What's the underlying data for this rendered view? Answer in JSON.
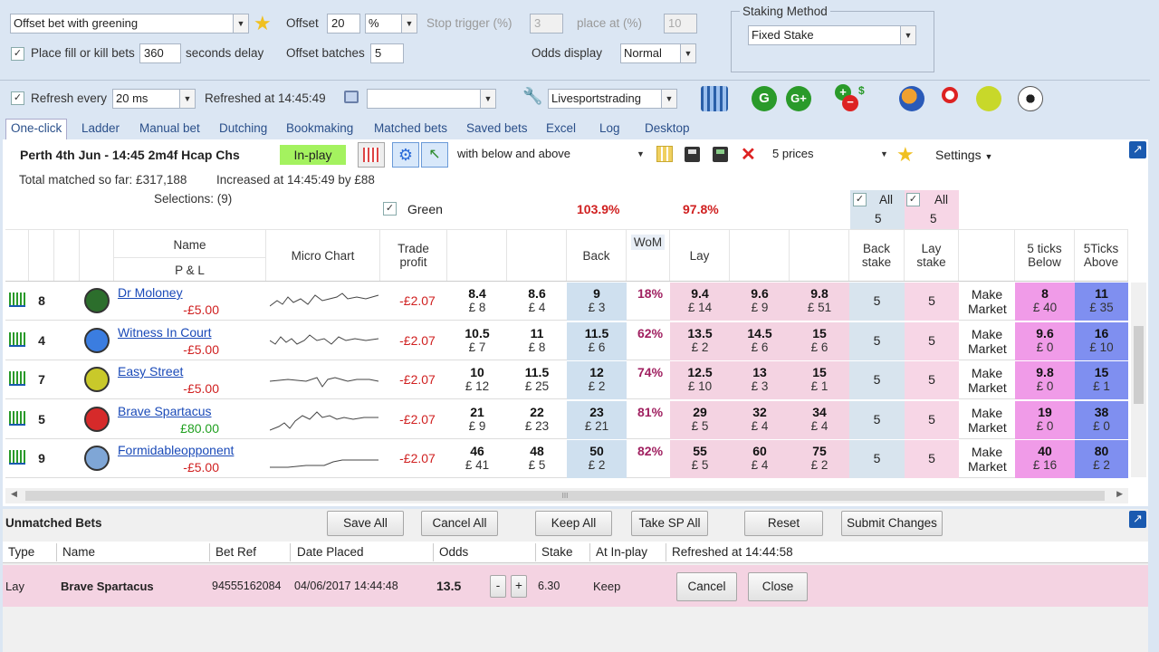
{
  "top": {
    "strategy": "Offset bet with greening",
    "offset_label": "Offset",
    "offset_value": "20",
    "offset_unit": "%",
    "stop_trigger_label": "Stop trigger (%)",
    "stop_trigger_value": "3",
    "place_at_label": "place at (%)",
    "place_at_value": "10",
    "fill_kill_label": "Place fill or kill bets",
    "fill_kill_value": "360",
    "seconds_delay_label": "seconds delay",
    "offset_batches_label": "Offset batches",
    "offset_batches_value": "5",
    "odds_display_label": "Odds display",
    "odds_display_value": "Normal",
    "staking_method_title": "Staking Method",
    "staking_method_value": "Fixed Stake",
    "refresh_label": "Refresh every",
    "refresh_value": "20 ms",
    "refreshed_at": "Refreshed at 14:45:49",
    "source_value": "Livesportstrading"
  },
  "tabs": [
    "One-click",
    "Ladder",
    "Manual bet",
    "Dutching",
    "Bookmaking",
    "Matched bets",
    "Saved bets",
    "Excel",
    "Log",
    "Desktop"
  ],
  "market": {
    "title": "Perth 4th Jun - 14:45 2m4f Hcap Chs",
    "status": "In-play",
    "filter": "with below and above",
    "prices": "5 prices",
    "settings": "Settings",
    "total_matched": "Total matched so far: £317,188",
    "increased": "Increased at 14:45:49 by £88",
    "selections": "Selections: (9)",
    "green_label": "Green",
    "back_book": "103.9%",
    "lay_book": "97.8%",
    "all_label": "All",
    "all_back_stake": "5",
    "all_lay_stake": "5"
  },
  "columns": {
    "name": "Name",
    "pl": "P & L",
    "micro_chart": "Micro Chart",
    "trade_profit": "Trade profit",
    "back": "Back",
    "wom": "WoM",
    "lay": "Lay",
    "back_stake": "Back stake",
    "lay_stake": "Lay stake",
    "ticks_below": "5 ticks Below",
    "ticks_above": "5Ticks Above"
  },
  "runners": [
    {
      "num": "8",
      "name": "Dr Moloney",
      "pl": "-£5.00",
      "trade": "-£2.07",
      "b3": "8.4",
      "b3s": "£ 8",
      "b2": "8.6",
      "b2s": "£ 4",
      "b1": "9",
      "b1s": "£ 3",
      "wom": "18%",
      "l1": "9.4",
      "l1s": "£ 14",
      "l2": "9.6",
      "l2s": "£ 9",
      "l3": "9.8",
      "l3s": "£ 51",
      "bs": "5",
      "ls": "5",
      "mm": "Make Market",
      "tb": "8",
      "tbs": "£ 40",
      "ta": "11",
      "tas": "£ 35",
      "silk": "#2c6e2c"
    },
    {
      "num": "4",
      "name": "Witness In Court",
      "pl": "-£5.00",
      "trade": "-£2.07",
      "b3": "10.5",
      "b3s": "£ 7",
      "b2": "11",
      "b2s": "£ 8",
      "b1": "11.5",
      "b1s": "£ 6",
      "wom": "62%",
      "l1": "13.5",
      "l1s": "£ 2",
      "l2": "14.5",
      "l2s": "£ 6",
      "l3": "15",
      "l3s": "£ 6",
      "bs": "5",
      "ls": "5",
      "mm": "Make Market",
      "tb": "9.6",
      "tbs": "£ 0",
      "ta": "16",
      "tas": "£ 10",
      "silk": "#3b7de0"
    },
    {
      "num": "7",
      "name": "Easy Street",
      "pl": "-£5.00",
      "trade": "-£2.07",
      "b3": "10",
      "b3s": "£ 12",
      "b2": "11.5",
      "b2s": "£ 25",
      "b1": "12",
      "b1s": "£ 2",
      "wom": "74%",
      "l1": "12.5",
      "l1s": "£ 10",
      "l2": "13",
      "l2s": "£ 3",
      "l3": "15",
      "l3s": "£ 1",
      "bs": "5",
      "ls": "5",
      "mm": "Make Market",
      "tb": "9.8",
      "tbs": "£ 0",
      "ta": "15",
      "tas": "£ 1",
      "silk": "#c9c92a"
    },
    {
      "num": "5",
      "name": "Brave Spartacus",
      "pl": "£80.00",
      "trade": "-£2.07",
      "b3": "21",
      "b3s": "£ 9",
      "b2": "22",
      "b2s": "£ 23",
      "b1": "23",
      "b1s": "£ 21",
      "wom": "81%",
      "l1": "29",
      "l1s": "£ 5",
      "l2": "32",
      "l2s": "£ 4",
      "l3": "34",
      "l3s": "£ 4",
      "bs": "5",
      "ls": "5",
      "mm": "Make Market",
      "tb": "19",
      "tbs": "£ 0",
      "ta": "38",
      "tas": "£ 0",
      "silk": "#d62a2a"
    },
    {
      "num": "9",
      "name": "Formidableopponent",
      "pl": "-£5.00",
      "trade": "-£2.07",
      "b3": "46",
      "b3s": "£ 41",
      "b2": "48",
      "b2s": "£ 5",
      "b1": "50",
      "b1s": "£ 2",
      "wom": "82%",
      "l1": "55",
      "l1s": "£ 5",
      "l2": "60",
      "l2s": "£ 4",
      "l3": "75",
      "l3s": "£ 2",
      "bs": "5",
      "ls": "5",
      "mm": "Make Market",
      "tb": "40",
      "tbs": "£ 16",
      "ta": "80",
      "tas": "£ 2",
      "silk": "#7fa6d6"
    }
  ],
  "unmatched": {
    "title": "Unmatched Bets",
    "buttons": [
      "Save All",
      "Cancel All",
      "Keep All",
      "Take SP All",
      "Reset",
      "Submit Changes"
    ],
    "headers": [
      "Type",
      "Name",
      "Bet Ref",
      "Date Placed",
      "Odds",
      "Stake",
      "At In-play",
      "Refreshed at 14:44:58"
    ],
    "bet": {
      "type": "Lay",
      "name": "Brave Spartacus",
      "ref": "94555162084",
      "date": "04/06/2017 14:44:48",
      "odds": "13.5",
      "minus": "-",
      "plus": "+",
      "stake": "6.30",
      "inplay": "Keep",
      "cancel": "Cancel",
      "close": "Close"
    }
  },
  "scroll_grip": "III",
  "colors": {
    "back": "#cfe0ef",
    "lay": "#f4d3e2",
    "ticks_below": "#f09be8",
    "ticks_above": "#7f8ff0",
    "inplay": "#a4f25f",
    "negative": "#d02020",
    "positive": "#20a020"
  }
}
